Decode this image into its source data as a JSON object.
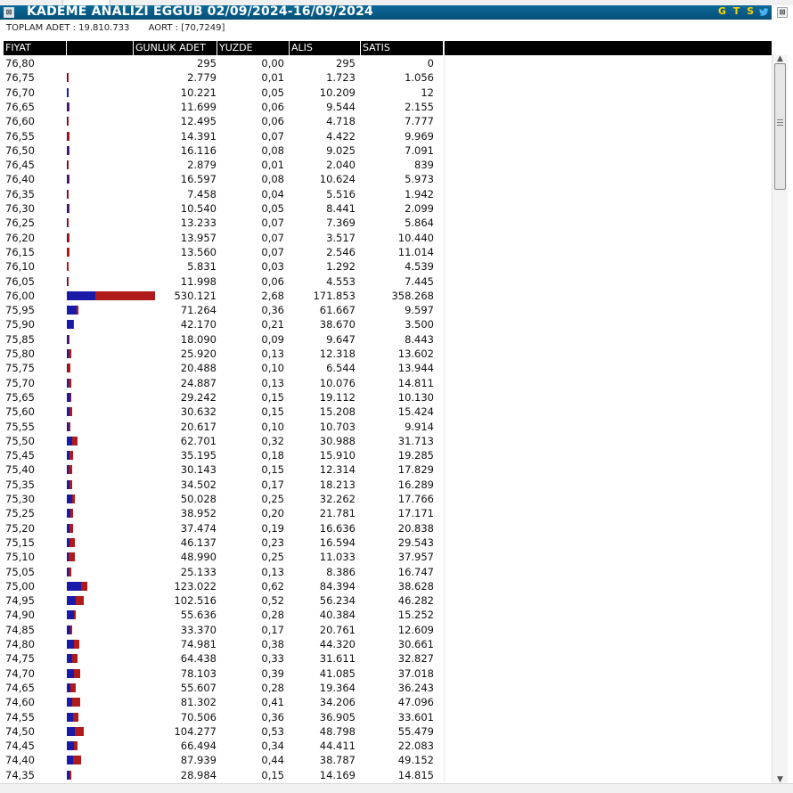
{
  "window": {
    "title": "KADEME ANALIZI EGGUB 02/09/2024-16/09/2024",
    "brand": "G T S",
    "accent": "#0a5d8a",
    "buy_color": "#1a1aa8",
    "sell_color": "#b01a1a"
  },
  "info": {
    "toplam_adet": "TOPLAM ADET : 19.810.733",
    "aort": "AORT :  [70,7249]"
  },
  "columns": [
    "FIYAT",
    "GUNLUK ADET",
    "YUZDE",
    "ALIS",
    "SATIS"
  ],
  "rows": [
    [
      "76,80",
      "295",
      "0,00",
      "295",
      "0"
    ],
    [
      "76,75",
      "2.779",
      "0,01",
      "1.723",
      "1.056"
    ],
    [
      "76,70",
      "10.221",
      "0,05",
      "10.209",
      "12"
    ],
    [
      "76,65",
      "11.699",
      "0,06",
      "9.544",
      "2.155"
    ],
    [
      "76,60",
      "12.495",
      "0,06",
      "4.718",
      "7.777"
    ],
    [
      "76,55",
      "14.391",
      "0,07",
      "4.422",
      "9.969"
    ],
    [
      "76,50",
      "16.116",
      "0,08",
      "9.025",
      "7.091"
    ],
    [
      "76,45",
      "2.879",
      "0,01",
      "2.040",
      "839"
    ],
    [
      "76,40",
      "16.597",
      "0,08",
      "10.624",
      "5.973"
    ],
    [
      "76,35",
      "7.458",
      "0,04",
      "5.516",
      "1.942"
    ],
    [
      "76,30",
      "10.540",
      "0,05",
      "8.441",
      "2.099"
    ],
    [
      "76,25",
      "13.233",
      "0,07",
      "7.369",
      "5.864"
    ],
    [
      "76,20",
      "13.957",
      "0,07",
      "3.517",
      "10.440"
    ],
    [
      "76,15",
      "13.560",
      "0,07",
      "2.546",
      "11.014"
    ],
    [
      "76,10",
      "5.831",
      "0,03",
      "1.292",
      "4.539"
    ],
    [
      "76,05",
      "11.998",
      "0,06",
      "4.553",
      "7.445"
    ],
    [
      "76,00",
      "530.121",
      "2,68",
      "171.853",
      "358.268"
    ],
    [
      "75,95",
      "71.264",
      "0,36",
      "61.667",
      "9.597"
    ],
    [
      "75,90",
      "42.170",
      "0,21",
      "38.670",
      "3.500"
    ],
    [
      "75,85",
      "18.090",
      "0,09",
      "9.647",
      "8.443"
    ],
    [
      "75,80",
      "25.920",
      "0,13",
      "12.318",
      "13.602"
    ],
    [
      "75,75",
      "20.488",
      "0,10",
      "6.544",
      "13.944"
    ],
    [
      "75,70",
      "24.887",
      "0,13",
      "10.076",
      "14.811"
    ],
    [
      "75,65",
      "29.242",
      "0,15",
      "19.112",
      "10.130"
    ],
    [
      "75,60",
      "30.632",
      "0,15",
      "15.208",
      "15.424"
    ],
    [
      "75,55",
      "20.617",
      "0,10",
      "10.703",
      "9.914"
    ],
    [
      "75,50",
      "62.701",
      "0,32",
      "30.988",
      "31.713"
    ],
    [
      "75,45",
      "35.195",
      "0,18",
      "15.910",
      "19.285"
    ],
    [
      "75,40",
      "30.143",
      "0,15",
      "12.314",
      "17.829"
    ],
    [
      "75,35",
      "34.502",
      "0,17",
      "18.213",
      "16.289"
    ],
    [
      "75,30",
      "50.028",
      "0,25",
      "32.262",
      "17.766"
    ],
    [
      "75,25",
      "38.952",
      "0,20",
      "21.781",
      "17.171"
    ],
    [
      "75,20",
      "37.474",
      "0,19",
      "16.636",
      "20.838"
    ],
    [
      "75,15",
      "46.137",
      "0,23",
      "16.594",
      "29.543"
    ],
    [
      "75,10",
      "48.990",
      "0,25",
      "11.033",
      "37.957"
    ],
    [
      "75,05",
      "25.133",
      "0,13",
      "8.386",
      "16.747"
    ],
    [
      "75,00",
      "123.022",
      "0,62",
      "84.394",
      "38.628"
    ],
    [
      "74,95",
      "102.516",
      "0,52",
      "56.234",
      "46.282"
    ],
    [
      "74,90",
      "55.636",
      "0,28",
      "40.384",
      "15.252"
    ],
    [
      "74,85",
      "33.370",
      "0,17",
      "20.761",
      "12.609"
    ],
    [
      "74,80",
      "74.981",
      "0,38",
      "44.320",
      "30.661"
    ],
    [
      "74,75",
      "64.438",
      "0,33",
      "31.611",
      "32.827"
    ],
    [
      "74,70",
      "78.103",
      "0,39",
      "41.085",
      "37.018"
    ],
    [
      "74,65",
      "55.607",
      "0,28",
      "19.364",
      "36.243"
    ],
    [
      "74,60",
      "81.302",
      "0,41",
      "34.206",
      "47.096"
    ],
    [
      "74,55",
      "70.506",
      "0,36",
      "36.905",
      "33.601"
    ],
    [
      "74,50",
      "104.277",
      "0,53",
      "48.798",
      "55.479"
    ],
    [
      "74,45",
      "66.494",
      "0,34",
      "44.411",
      "22.083"
    ],
    [
      "74,40",
      "87.939",
      "0,44",
      "38.787",
      "49.152"
    ],
    [
      "74,35",
      "28.984",
      "0,15",
      "14.169",
      "14.815"
    ]
  ]
}
